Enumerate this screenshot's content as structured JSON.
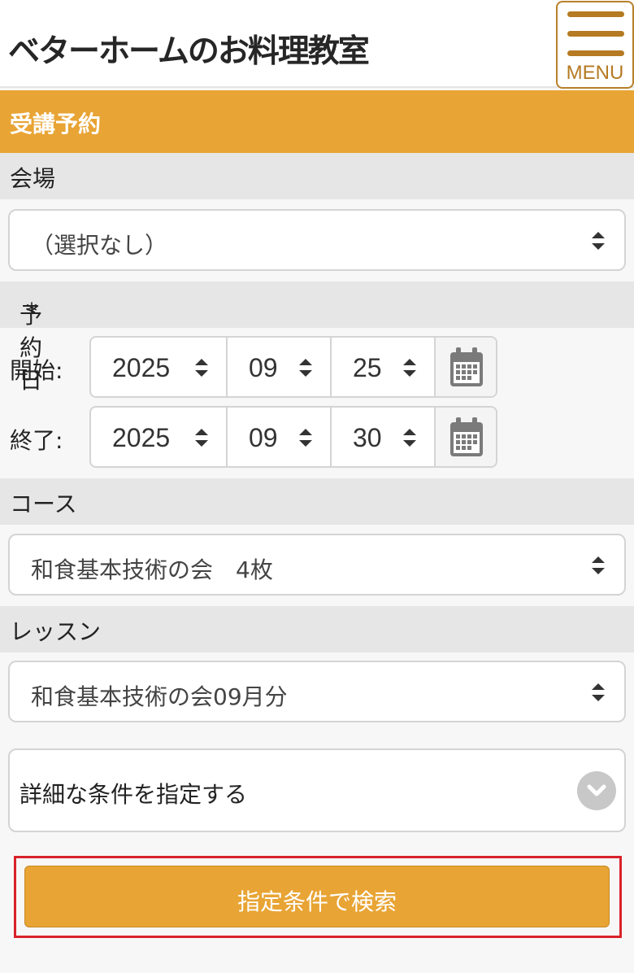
{
  "header": {
    "logo_text": "ベターホームのお料理教室",
    "menu_label": "MENU"
  },
  "page_title": "受講予約",
  "venue": {
    "label": "会場",
    "selected": "（選択なし）"
  },
  "reservation_date": {
    "label": "予約日",
    "required_mark": "*",
    "start": {
      "label": "開始:",
      "year": "2025",
      "month": "09",
      "day": "25"
    },
    "end": {
      "label": "終了:",
      "year": "2025",
      "month": "09",
      "day": "30"
    }
  },
  "course": {
    "label": "コース",
    "selected": "和食基本技術の会　4枚"
  },
  "lesson": {
    "label": "レッスン",
    "selected": "和食基本技術の会09月分"
  },
  "advanced": {
    "label": "詳細な条件を指定する"
  },
  "search_button": {
    "label": "指定条件で検索"
  },
  "colors": {
    "accent": "#e8a434",
    "menu_brown": "#b57a22",
    "required_red": "#d11f1f",
    "highlight_red": "#d9222a"
  },
  "icons": [
    "menu-icon",
    "calendar-icon",
    "chevron-down-icon",
    "select-arrows-icon"
  ]
}
